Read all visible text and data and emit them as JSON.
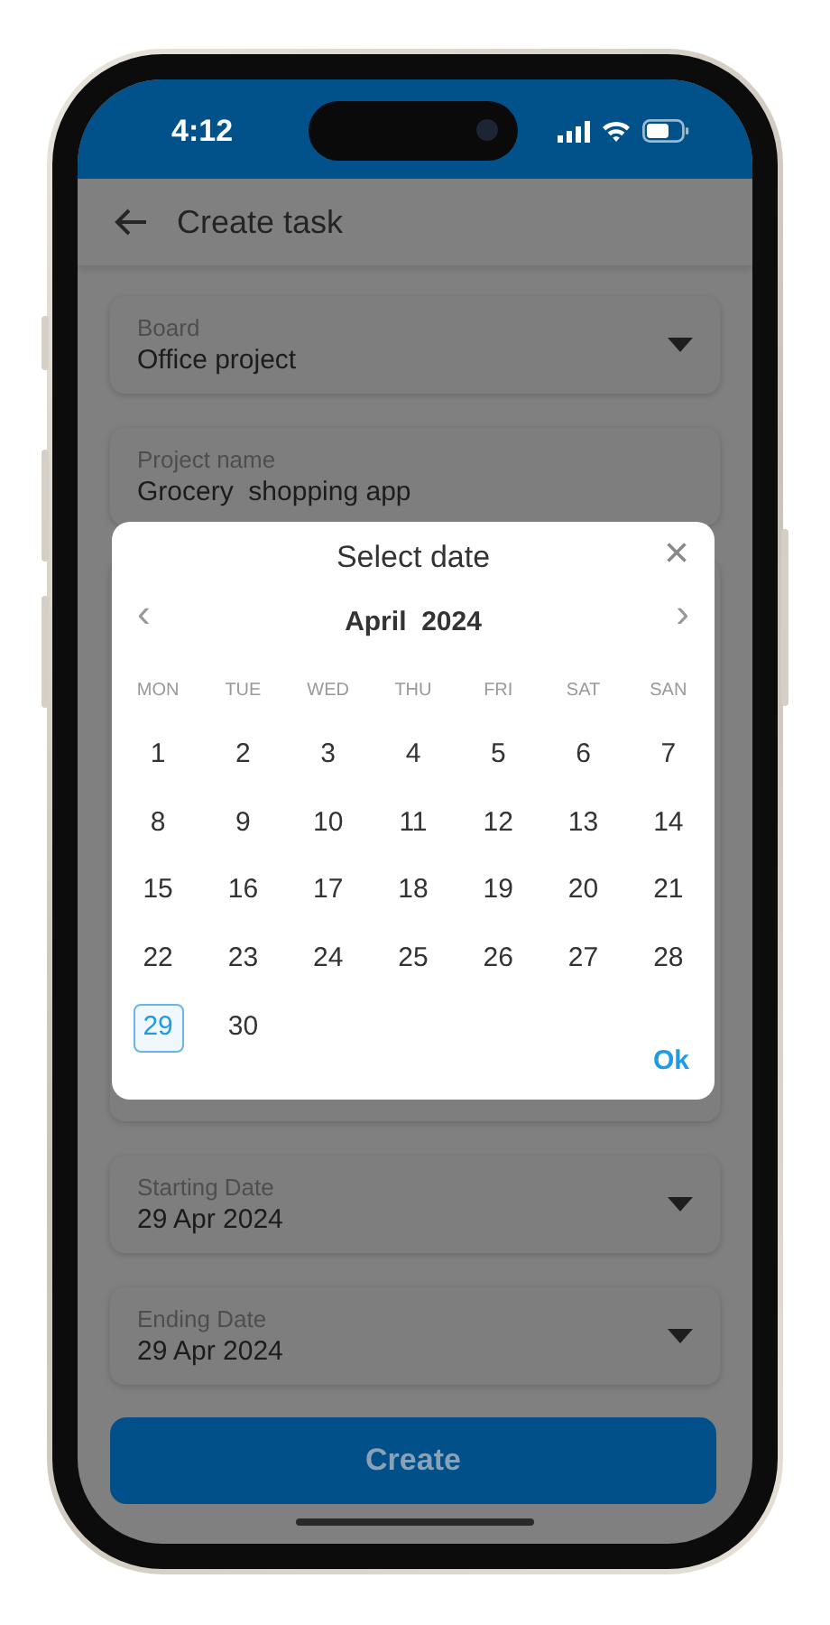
{
  "status_bar": {
    "time": "4:12"
  },
  "header": {
    "title": "Create task"
  },
  "fields_top": [
    {
      "label": "Board",
      "value": "Office project",
      "dropdown": true
    },
    {
      "label": "Project name",
      "value": "Grocery  shopping app",
      "dropdown": false
    }
  ],
  "fields_bottom": [
    {
      "label": "Starting Date",
      "value": "29 Apr 2024",
      "dropdown": true
    },
    {
      "label": "Ending Date",
      "value": "29 Apr 2024",
      "dropdown": true
    }
  ],
  "create_button": "Create",
  "dialog": {
    "title": "Select date",
    "close": "×",
    "prev": "‹",
    "next": "›",
    "month": "April  2024",
    "weekdays": [
      "MON",
      "TUE",
      "WED",
      "THU",
      "FRI",
      "SAT",
      "SAN"
    ],
    "days": [
      {
        "label": "1",
        "selected": false
      },
      {
        "label": "2",
        "selected": false
      },
      {
        "label": "3",
        "selected": false
      },
      {
        "label": "4",
        "selected": false
      },
      {
        "label": "5",
        "selected": false
      },
      {
        "label": "6",
        "selected": false
      },
      {
        "label": "7",
        "selected": false
      },
      {
        "label": "8",
        "selected": false
      },
      {
        "label": "9",
        "selected": false
      },
      {
        "label": "10",
        "selected": false
      },
      {
        "label": "11",
        "selected": false
      },
      {
        "label": "12",
        "selected": false
      },
      {
        "label": "13",
        "selected": false
      },
      {
        "label": "14",
        "selected": false
      },
      {
        "label": "15",
        "selected": false
      },
      {
        "label": "16",
        "selected": false
      },
      {
        "label": "17",
        "selected": false
      },
      {
        "label": "18",
        "selected": false
      },
      {
        "label": "19",
        "selected": false
      },
      {
        "label": "20",
        "selected": false
      },
      {
        "label": "21",
        "selected": false
      },
      {
        "label": "22",
        "selected": false
      },
      {
        "label": "23",
        "selected": false
      },
      {
        "label": "24",
        "selected": false
      },
      {
        "label": "25",
        "selected": false
      },
      {
        "label": "26",
        "selected": false
      },
      {
        "label": "27",
        "selected": false
      },
      {
        "label": "28",
        "selected": false
      },
      {
        "label": "29",
        "selected": true
      },
      {
        "label": "30",
        "selected": false
      }
    ],
    "ok": "Ok"
  }
}
